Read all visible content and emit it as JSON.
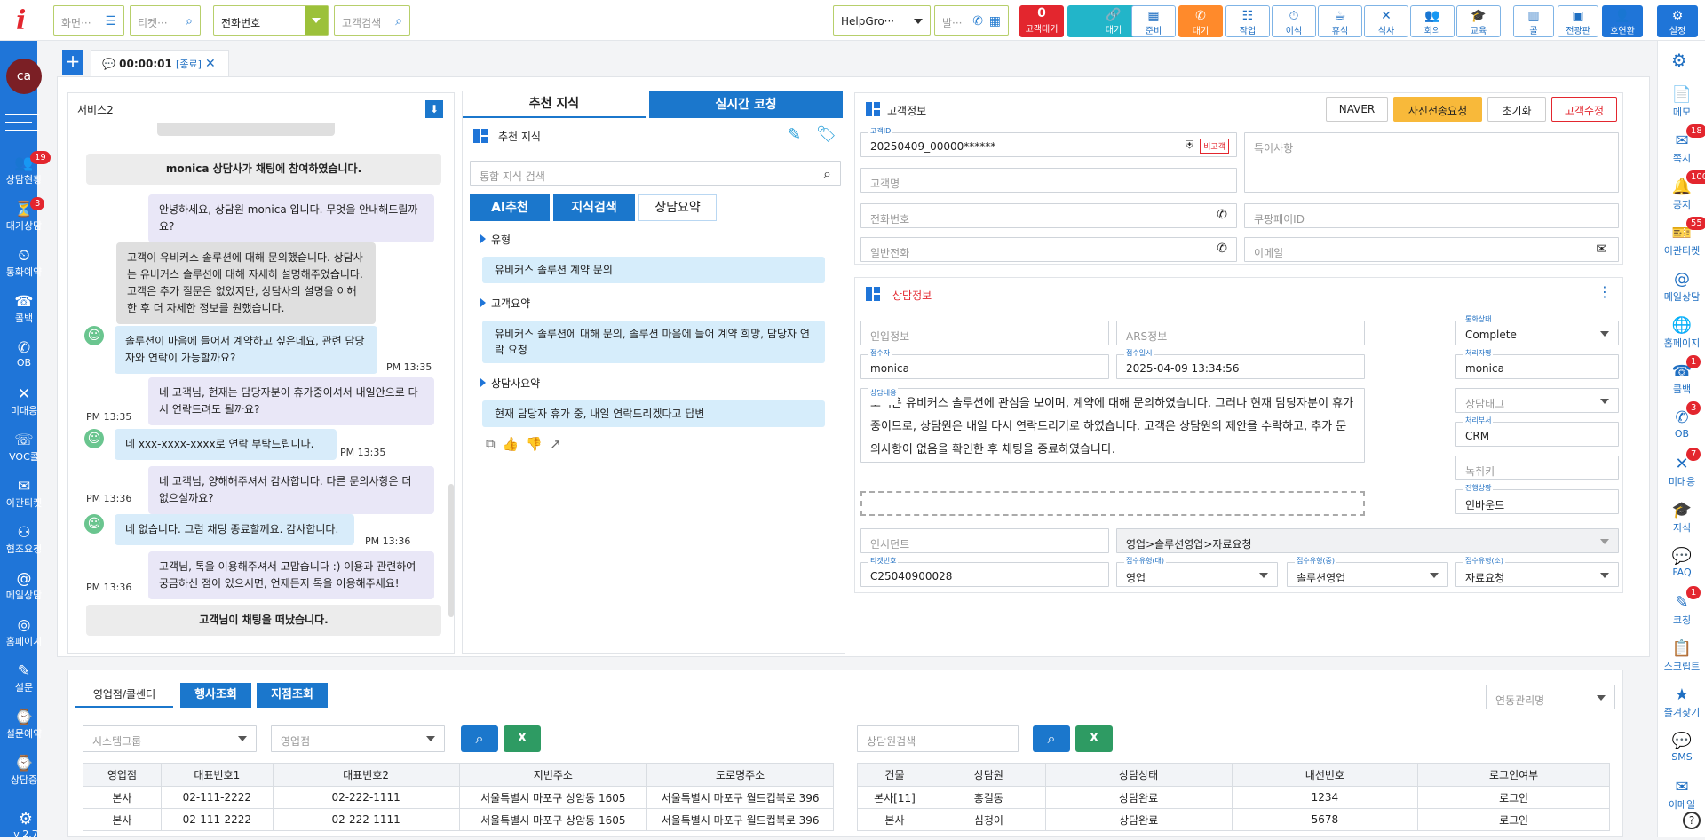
{
  "app": {
    "logo": "i",
    "version": "v 2.7"
  },
  "topbar": {
    "screen_search": "화면···",
    "ticket_search": "티켓···",
    "phone_select": "전화번호",
    "customer_search": "고객검색",
    "group_select": "HelpGro···",
    "outbound_field": "발···",
    "wait_count": "0",
    "wait_label": "고객대기",
    "buttons": [
      {
        "label": "대기",
        "icon": "link-icon"
      },
      {
        "label": "준비",
        "icon": "grid-icon"
      },
      {
        "label": "대기",
        "icon": "phone-icon"
      },
      {
        "label": "작업",
        "icon": "task-icon"
      },
      {
        "label": "이석",
        "icon": "away-icon"
      },
      {
        "label": "휴식",
        "icon": "rest-icon"
      },
      {
        "label": "식사",
        "icon": "meal-icon"
      },
      {
        "label": "회의",
        "icon": "meeting-icon"
      },
      {
        "label": "교육",
        "icon": "education-icon"
      }
    ],
    "right_buttons": [
      {
        "label": "콜",
        "icon": "chart-icon"
      },
      {
        "label": "전광판",
        "icon": "board-icon"
      },
      {
        "label": "호연환",
        "icon": "user-icon"
      },
      {
        "label": "설정",
        "icon": "gear-icon"
      }
    ]
  },
  "leftnav": {
    "avatar": "ca",
    "items": [
      {
        "label": "상담현황",
        "badge": "19"
      },
      {
        "label": "대기상담",
        "badge": "3"
      },
      {
        "label": "통화예약",
        "badge": ""
      },
      {
        "label": "콜백",
        "badge": ""
      },
      {
        "label": "OB",
        "badge": ""
      },
      {
        "label": "미대응",
        "badge": ""
      },
      {
        "label": "VOC콜",
        "badge": ""
      },
      {
        "label": "이관티켓",
        "badge": ""
      },
      {
        "label": "협조요청",
        "badge": ""
      },
      {
        "label": "메일상담",
        "badge": ""
      },
      {
        "label": "홈페이지",
        "badge": ""
      },
      {
        "label": "설문",
        "badge": ""
      },
      {
        "label": "설문예약",
        "badge": ""
      },
      {
        "label": "상담중",
        "badge": ""
      }
    ]
  },
  "rightnav": {
    "items": [
      {
        "label": "메모",
        "badge": ""
      },
      {
        "label": "쪽지",
        "badge": "18"
      },
      {
        "label": "공지",
        "badge": "100"
      },
      {
        "label": "이관티켓",
        "badge": "55"
      },
      {
        "label": "메일상담",
        "badge": ""
      },
      {
        "label": "홈페이지",
        "badge": ""
      },
      {
        "label": "콜백",
        "badge": "1"
      },
      {
        "label": "OB",
        "badge": "3"
      },
      {
        "label": "미대응",
        "badge": "7"
      },
      {
        "label": "지식",
        "badge": ""
      },
      {
        "label": "FAQ",
        "badge": ""
      },
      {
        "label": "코칭",
        "badge": "1"
      },
      {
        "label": "스크립트",
        "badge": ""
      },
      {
        "label": "즐겨찾기",
        "badge": ""
      },
      {
        "label": "SMS",
        "badge": ""
      },
      {
        "label": "이메일",
        "badge": ""
      }
    ]
  },
  "session_tab": {
    "plus": "+",
    "timer": "00:00:01",
    "status": "[종료]"
  },
  "chat": {
    "title": "서비스2",
    "messages": [
      {
        "type": "sys",
        "text": "monica 상담사가 채팅에 참여하였습니다."
      },
      {
        "type": "agent",
        "text": "안녕하세요, 상담원 monica 입니다. 무엇을 안내해드릴까요?"
      },
      {
        "type": "grey",
        "text": "고객이 유비커스 솔루션에 대해 문의했습니다. 상담사는 유비커스 솔루션에 대해 자세히 설명해주었습니다. 고객은 추가 질문은 없었지만, 상담사의 설명을 이해한 후 더 자세한 정보를 원했습니다."
      },
      {
        "type": "cust",
        "text": "솔루션이 마음에 들어서 계약하고 싶은데요, 관련 담당자와 연락이 가능할까요?",
        "time": "PM 13:35"
      },
      {
        "type": "agent",
        "text": "네 고객님, 현재는 담당자분이 휴가중이셔서 내일안으로 다시 연락드려도 될까요?",
        "time": "PM 13:35"
      },
      {
        "type": "cust",
        "text": "네 xxx-xxxx-xxxx로 연락 부탁드립니다.",
        "time": "PM 13:35"
      },
      {
        "type": "agent",
        "text": "네 고객님, 양해해주셔서 감사합니다. 다른 문의사항은 더 없으실까요?",
        "time": "PM 13:36"
      },
      {
        "type": "cust",
        "text": "네 없습니다. 그럼 채팅 종료할께요. 감사합니다.",
        "time": "PM 13:36"
      },
      {
        "type": "agent",
        "text": "고객님, 톡을 이용해주셔서 고맙습니다 :) 이용과 관련하여 궁금하신 점이 있으시면, 언제든지 톡을 이용해주세요!",
        "time": "PM 13:36"
      },
      {
        "type": "sys",
        "text": "고객님이 채팅을 떠났습니다."
      }
    ]
  },
  "knowledge": {
    "tab_recommend": "추천 지식",
    "tab_coaching": "실시간 코칭",
    "header": "추천 지식",
    "search_placeholder": "통합 지식 검색",
    "btn_ai": "AI추천",
    "btn_search": "지식검색",
    "btn_summary": "상담요약",
    "sections": [
      {
        "title": "유형",
        "text": "유비커스 솔루션 계약 문의"
      },
      {
        "title": "고객요약",
        "text": "유비커스 솔루션에 대해 문의, 솔루션 마음에 들어 계약 희망, 담당자 연락 요청"
      },
      {
        "title": "상담사요약",
        "text": "현재 담당자 휴가 중, 내일 연락드리겠다고 답변"
      }
    ]
  },
  "customer": {
    "title": "고객정보",
    "btn_naver": "NAVER",
    "btn_photo": "사진전송요청",
    "btn_reset": "초기화",
    "btn_edit": "고객수정",
    "id_label": "고객ID",
    "id_value": "20250409_00000******",
    "vip_badge": "비고객",
    "name_ph": "고객명",
    "special_ph": "특이사항",
    "phone_ph": "전화번호",
    "coupang_ph": "쿠팡페이ID",
    "general_ph": "일반전화",
    "email_ph": "이메일"
  },
  "consult": {
    "title": "상담정보",
    "inflow_ph": "인입정보",
    "ars_ph": "ARS정보",
    "status_label": "통화상태",
    "status_value": "Complete",
    "receiver_label": "접수자",
    "receiver_value": "monica",
    "received_label": "접수일시",
    "received_value": "2025-04-09 13:34:56",
    "handler_label": "처리자명",
    "handler_value": "monica",
    "content_label": "상담내용",
    "content_value": "고객은 유비커스 솔루션에 관심을 보이며, 계약에 대해 문의하였습니다. 그러나 현재 담당자분이 휴가 중이므로, 상담원은 내일 다시 연락드리기로 하였습니다. 고객은 상담원의 제안을 수락하고, 추가 문의사항이 없음을 확인한 후 채팅을 종료하였습니다.",
    "tag_ph": "상담태그",
    "dept_label": "처리부서",
    "dept_value": "CRM",
    "record_ph": "녹취키",
    "progress_label": "진행상황",
    "progress_value": "인바운드",
    "incident_ph": "인시던트",
    "category_path": "영업>솔루션영업>자료요청",
    "ticket_label": "티켓번호",
    "ticket_value": "C25040900028",
    "type_l_label": "접수유형(대)",
    "type_l_value": "영업",
    "type_m_label": "접수유형(중)",
    "type_m_value": "솔루션영업",
    "type_s_label": "접수유형(소)",
    "type_s_value": "자료요청"
  },
  "bottom": {
    "tabs": [
      "영업점/콜센터",
      "행사조회",
      "지점조회"
    ],
    "select_year": "연동관리명",
    "sys_group_ph": "시스템그룹",
    "branch_ph": "영업점",
    "agent_search_ph": "상담원검색",
    "left_table": {
      "headers": [
        "영업점",
        "대표번호1",
        "대표번호2",
        "지번주소",
        "도로명주소"
      ],
      "rows": [
        [
          "본사",
          "02-111-2222",
          "02-222-1111",
          "서울특별시 마포구 상암동 1605",
          "서울특별시 마포구 월드컵북로 396"
        ],
        [
          "본사",
          "02-111-2222",
          "02-222-1111",
          "서울특별시 마포구 상암동 1605",
          "서울특별시 마포구 월드컵북로 396"
        ]
      ]
    },
    "right_table": {
      "headers": [
        "건물",
        "상담원",
        "상담상태",
        "내선번호",
        "로그인여부"
      ],
      "rows": [
        [
          "본사[11]",
          "홍길동",
          "상담완료",
          "1234",
          "로그인"
        ],
        [
          "본사",
          "심청이",
          "상담완료",
          "5678",
          "로그인"
        ]
      ]
    }
  }
}
